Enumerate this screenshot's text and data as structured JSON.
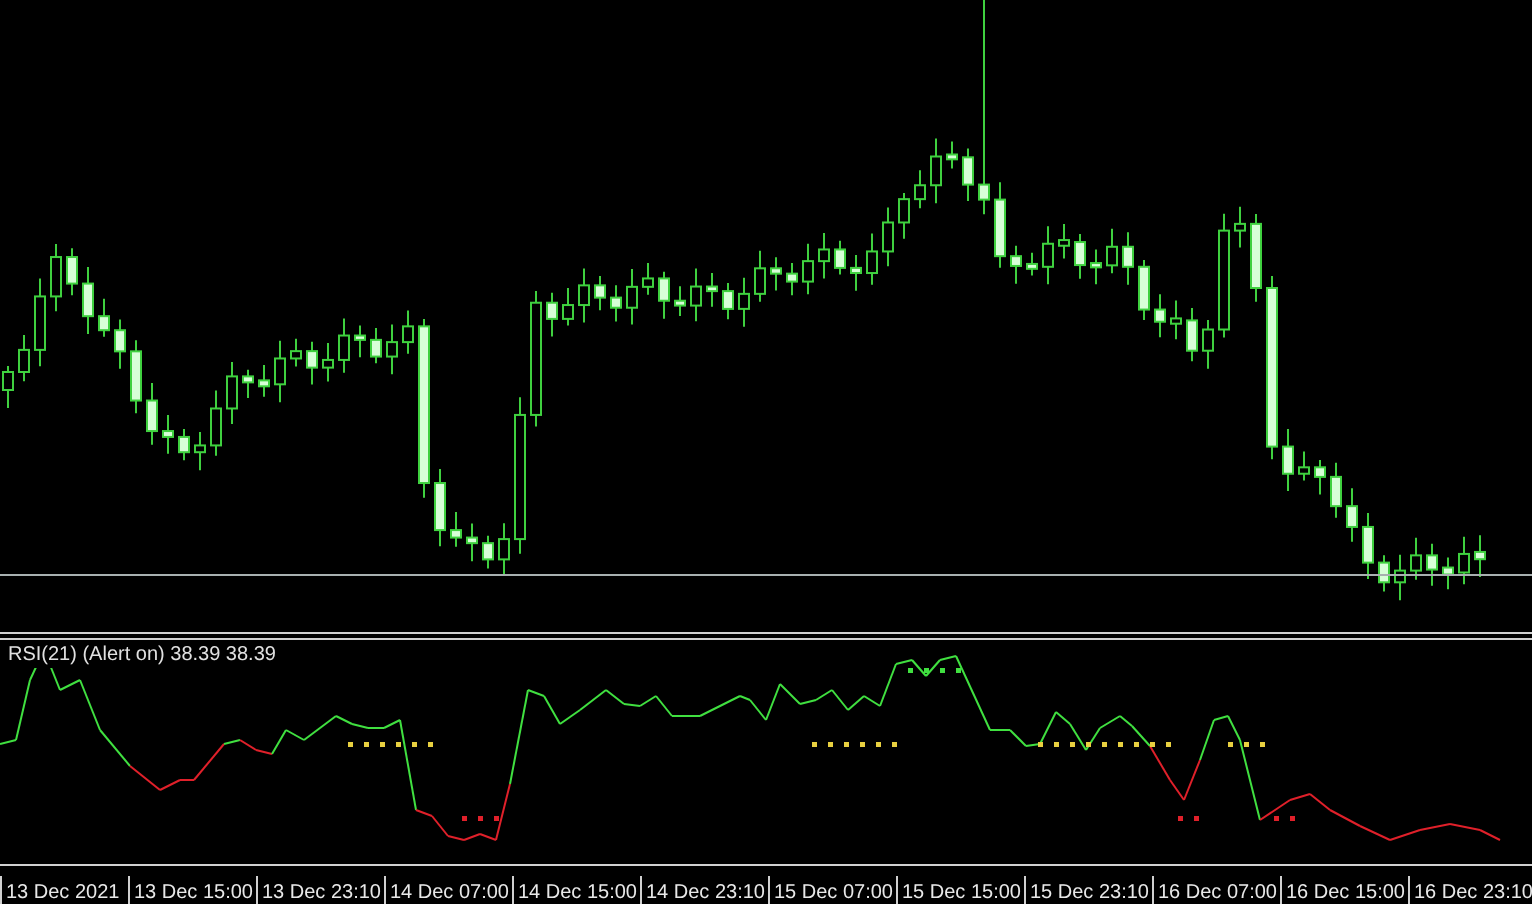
{
  "indicator": {
    "label": "RSI(21) (Alert on) 38.39 38.39"
  },
  "time_axis": {
    "labels": [
      "13 Dec 2021",
      "13 Dec 15:00",
      "13 Dec 23:10",
      "14 Dec 07:00",
      "14 Dec 15:00",
      "14 Dec 23:10",
      "15 Dec 07:00",
      "15 Dec 15:00",
      "15 Dec 23:10",
      "16 Dec 07:00",
      "16 Dec 15:00",
      "16 Dec 23:10"
    ]
  }
}
